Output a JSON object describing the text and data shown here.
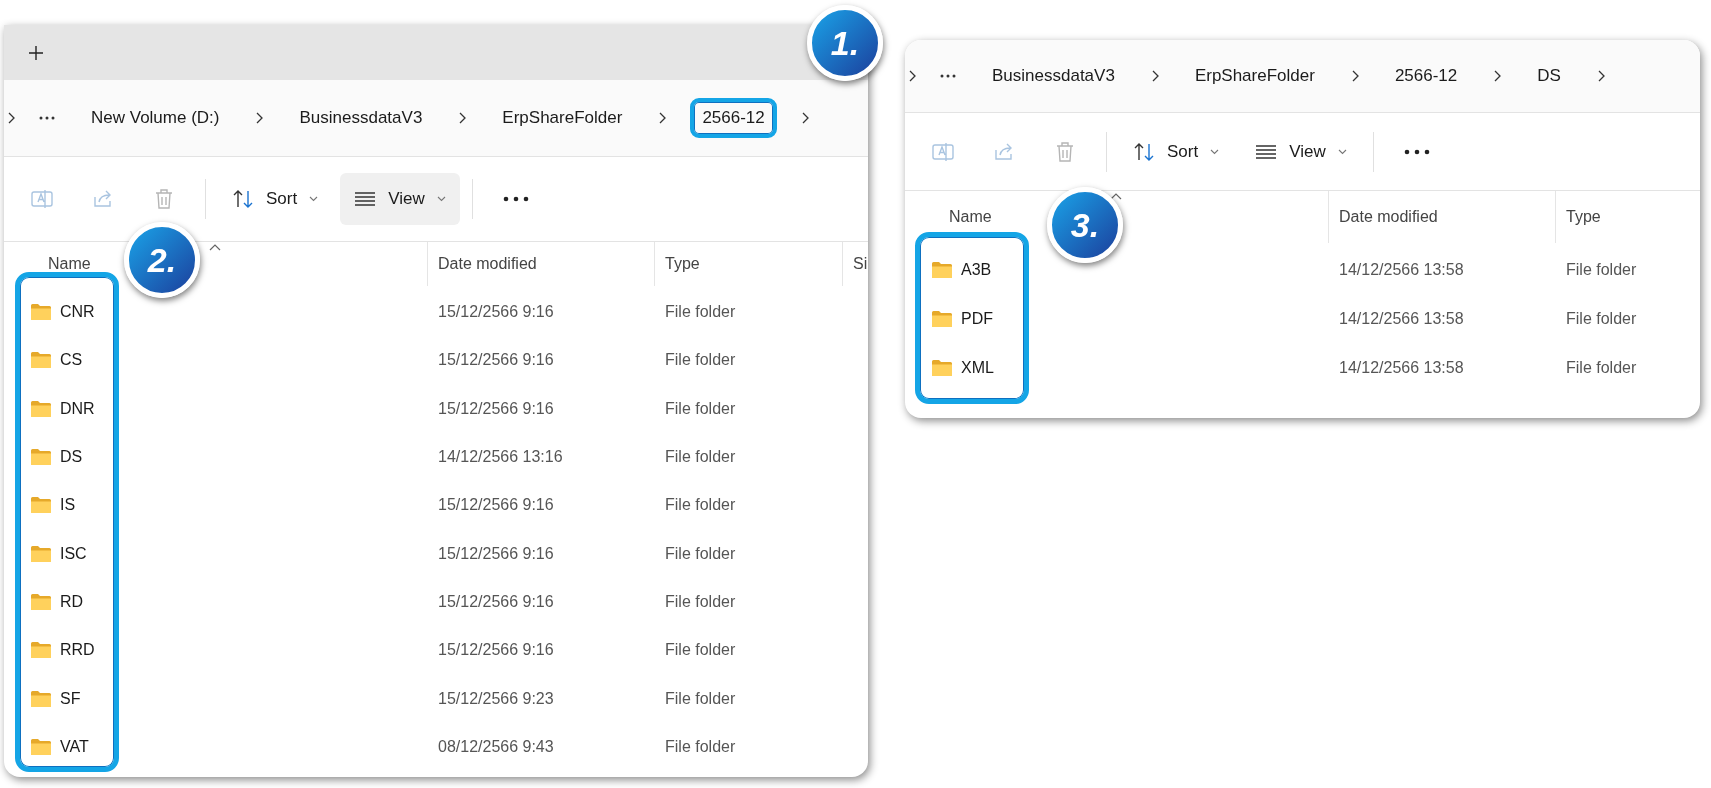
{
  "windows": [
    {
      "tab_strip": true,
      "breadcrumb": [
        {
          "label": "New Volume (D:)",
          "highlighted": false
        },
        {
          "label": "BusinessdataV3",
          "highlighted": false
        },
        {
          "label": "ErpShareFolder",
          "highlighted": false
        },
        {
          "label": "2566-12",
          "highlighted": true
        }
      ],
      "toolbar": {
        "sort": "Sort",
        "view": {
          "label": "View",
          "selected": true
        }
      },
      "columns": [
        "Name",
        "Date modified",
        "Type",
        "Si"
      ],
      "list_highlighted": true,
      "badges": [
        {
          "kind": "breadcrumb",
          "label": "1."
        },
        {
          "kind": "list",
          "label": "2."
        }
      ],
      "rows": [
        {
          "name": "CNR",
          "date": "15/12/2566 9:16",
          "type": "File folder"
        },
        {
          "name": "CS",
          "date": "15/12/2566 9:16",
          "type": "File folder"
        },
        {
          "name": "DNR",
          "date": "15/12/2566 9:16",
          "type": "File folder"
        },
        {
          "name": "DS",
          "date": "14/12/2566 13:16",
          "type": "File folder"
        },
        {
          "name": "IS",
          "date": "15/12/2566 9:16",
          "type": "File folder"
        },
        {
          "name": "ISC",
          "date": "15/12/2566 9:16",
          "type": "File folder"
        },
        {
          "name": "RD",
          "date": "15/12/2566 9:16",
          "type": "File folder"
        },
        {
          "name": "RRD",
          "date": "15/12/2566 9:16",
          "type": "File folder"
        },
        {
          "name": "SF",
          "date": "15/12/2566 9:23",
          "type": "File folder"
        },
        {
          "name": "VAT",
          "date": "08/12/2566 9:43",
          "type": "File folder"
        }
      ]
    },
    {
      "tab_strip": false,
      "breadcrumb": [
        {
          "label": "BusinessdataV3",
          "highlighted": false
        },
        {
          "label": "ErpShareFolder",
          "highlighted": false
        },
        {
          "label": "2566-12",
          "highlighted": false
        },
        {
          "label": "DS",
          "highlighted": false
        }
      ],
      "toolbar": {
        "sort": "Sort",
        "view": {
          "label": "View",
          "selected": false
        }
      },
      "columns": [
        "Name",
        "Date modified",
        "Type"
      ],
      "list_highlighted": true,
      "badges": [
        {
          "kind": "list",
          "label": "3."
        }
      ],
      "rows": [
        {
          "name": "A3B",
          "date": "14/12/2566 13:58",
          "type": "File folder"
        },
        {
          "name": "PDF",
          "date": "14/12/2566 13:58",
          "type": "File folder"
        },
        {
          "name": "XML",
          "date": "14/12/2566 13:58",
          "type": "File folder"
        }
      ]
    }
  ]
}
